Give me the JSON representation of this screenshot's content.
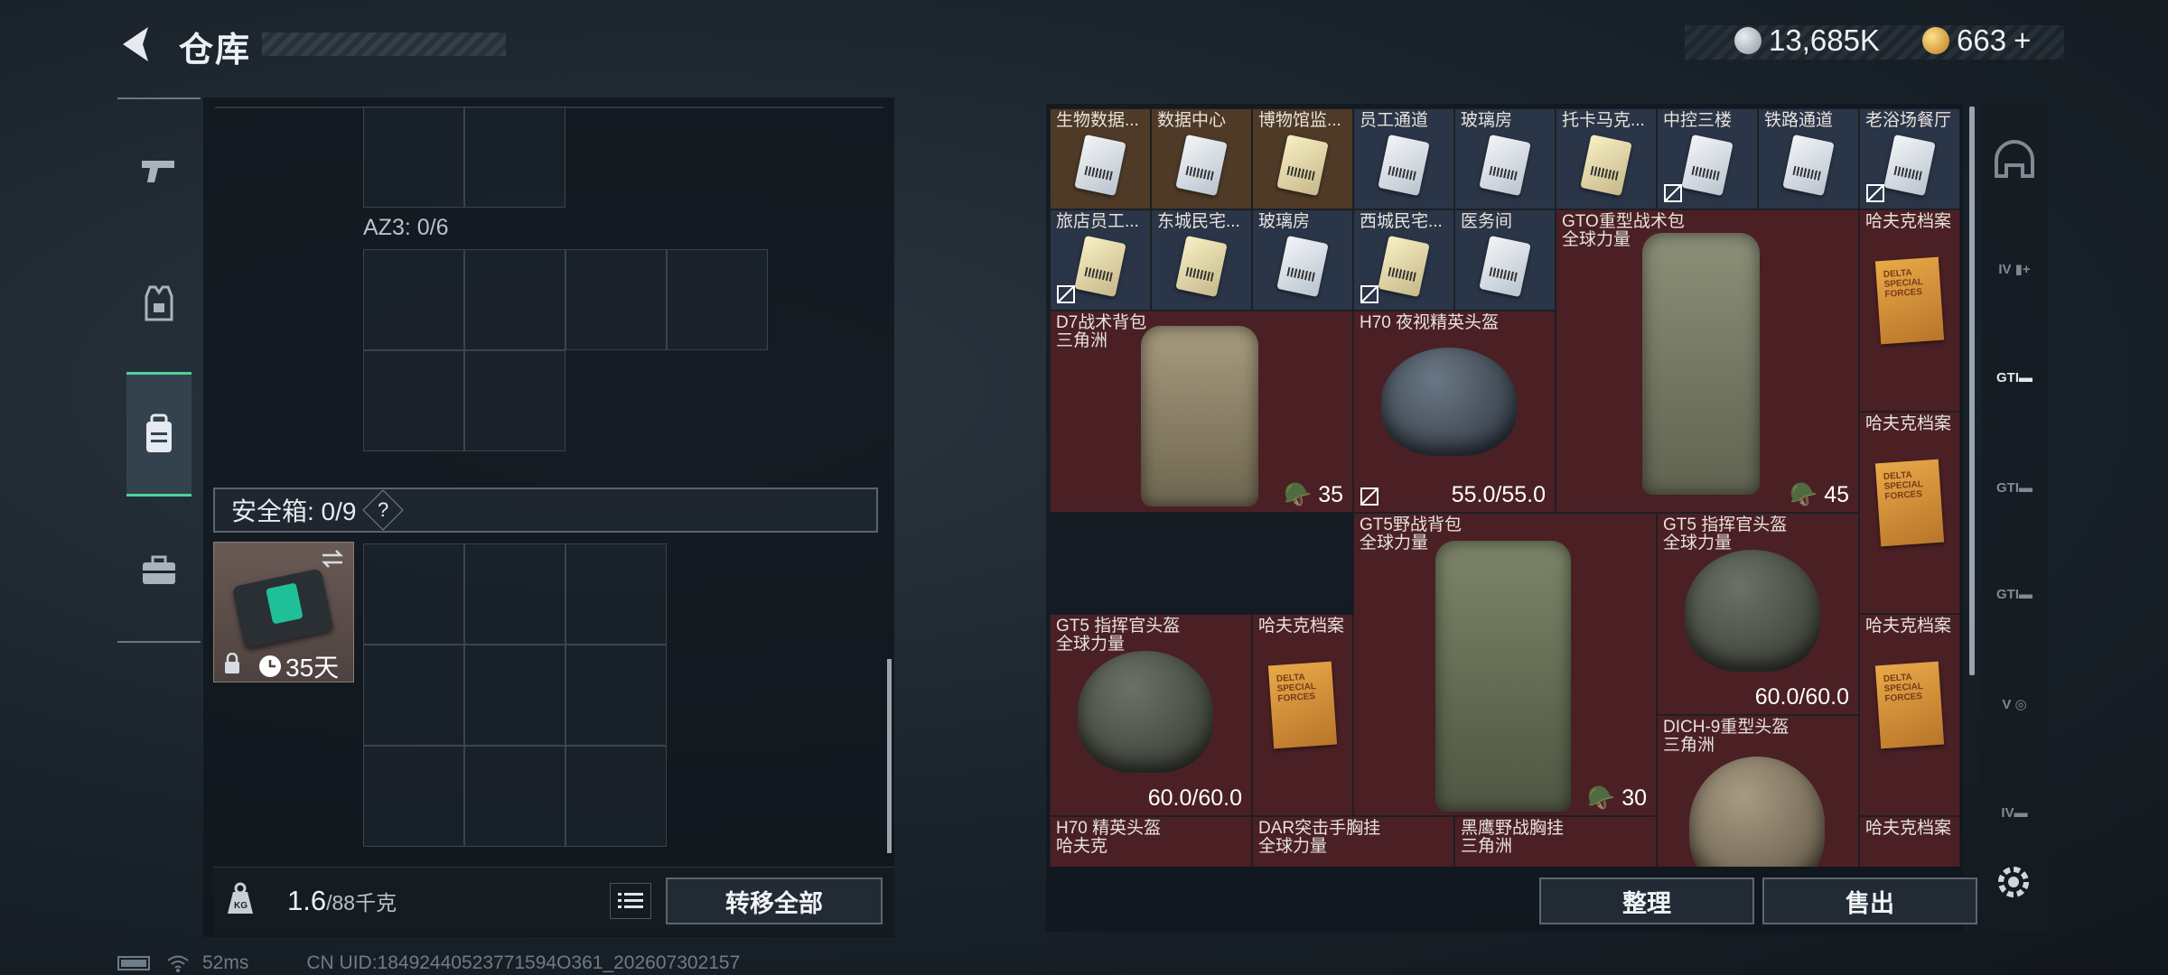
{
  "header": {
    "title": "仓库"
  },
  "currency": [
    {
      "icon": "silver-coin-icon",
      "value": "13,685K",
      "color": "#b8c0c8"
    },
    {
      "icon": "gold-coin-icon",
      "value": "663",
      "plus": "+",
      "color": "#d8a63a"
    }
  ],
  "left_panel": {
    "az3_label": "AZ3: 0/6",
    "safebox_label": "安全箱: 0/9",
    "safebox_help": "?",
    "safebox_item": {
      "days": "35天"
    }
  },
  "footer_left": {
    "weight_current": "1.6",
    "weight_max": "/88千克",
    "transfer_label": "转移全部"
  },
  "status": {
    "latency": "52ms",
    "uid": "CN UID:18492440523771594O361_202607302157"
  },
  "stash": {
    "keycards": [
      {
        "name": "生物数据...",
        "color": "gold"
      },
      {
        "name": "数据中心",
        "color": "gold"
      },
      {
        "name": "博物馆监...",
        "color": "gold"
      },
      {
        "name": "员工通道",
        "color": "blue"
      },
      {
        "name": "玻璃房",
        "color": "blue"
      },
      {
        "name": "托卡马克...",
        "color": "blue"
      },
      {
        "name": "中控三楼",
        "color": "blue"
      },
      {
        "name": "铁路通道",
        "color": "blue"
      },
      {
        "name": "老浴场餐厅",
        "color": "blue"
      },
      {
        "name": "旅店员工...",
        "color": "blue"
      },
      {
        "name": "东城民宅...",
        "color": "blue"
      },
      {
        "name": "玻璃房",
        "color": "blue"
      },
      {
        "name": "西城民宅...",
        "color": "blue"
      },
      {
        "name": "医务间",
        "color": "blue"
      }
    ],
    "items": [
      {
        "name": "GTO重型战术包",
        "sub": "全球力量",
        "count": "45"
      },
      {
        "name": "哈夫克档案",
        "sub": ""
      },
      {
        "name": "D7战术背包",
        "sub": "三角洲",
        "count": "35"
      },
      {
        "name": "H70 夜视精英头盔",
        "sub": "",
        "durability": "55.0/55.0"
      },
      {
        "name": "哈夫克档案",
        "sub": ""
      },
      {
        "name": "GT5野战背包",
        "sub": "全球力量",
        "count": "30"
      },
      {
        "name": "GT5 指挥官头盔",
        "sub": "全球力量",
        "durability": "60.0/60.0"
      },
      {
        "name": "哈夫克档案",
        "sub": ""
      },
      {
        "name": "GT5 指挥官头盔",
        "sub": "全球力量",
        "durability": "60.0/60.0"
      },
      {
        "name": "哈夫克档案",
        "sub": ""
      },
      {
        "name": "DICH-9重型头盔",
        "sub": "三角洲"
      },
      {
        "name": "H70 精英头盔",
        "sub": "哈夫克"
      },
      {
        "name": "DAR突击手胸挂",
        "sub": "全球力量"
      },
      {
        "name": "黑鹰野战胸挂",
        "sub": "三角洲"
      },
      {
        "name": "哈夫克档案",
        "sub": ""
      }
    ],
    "folder_text": "DELTA SPECIAL FORCES"
  },
  "footer_right": {
    "sort_label": "整理",
    "sell_label": "售出"
  },
  "right_rail": [
    {
      "icon": "helmet-slot-icon",
      "label": ""
    },
    {
      "icon": "iv-armor-add-icon",
      "label": "IV"
    },
    {
      "icon": "gti-plate-icon",
      "label": "GTI"
    },
    {
      "icon": "gti-tool-icon",
      "label": "GTI"
    },
    {
      "icon": "gti-vest-icon",
      "label": "GTI"
    },
    {
      "icon": "v-rig-icon",
      "label": "V"
    },
    {
      "icon": "iv-rig-icon",
      "label": "IV"
    }
  ]
}
